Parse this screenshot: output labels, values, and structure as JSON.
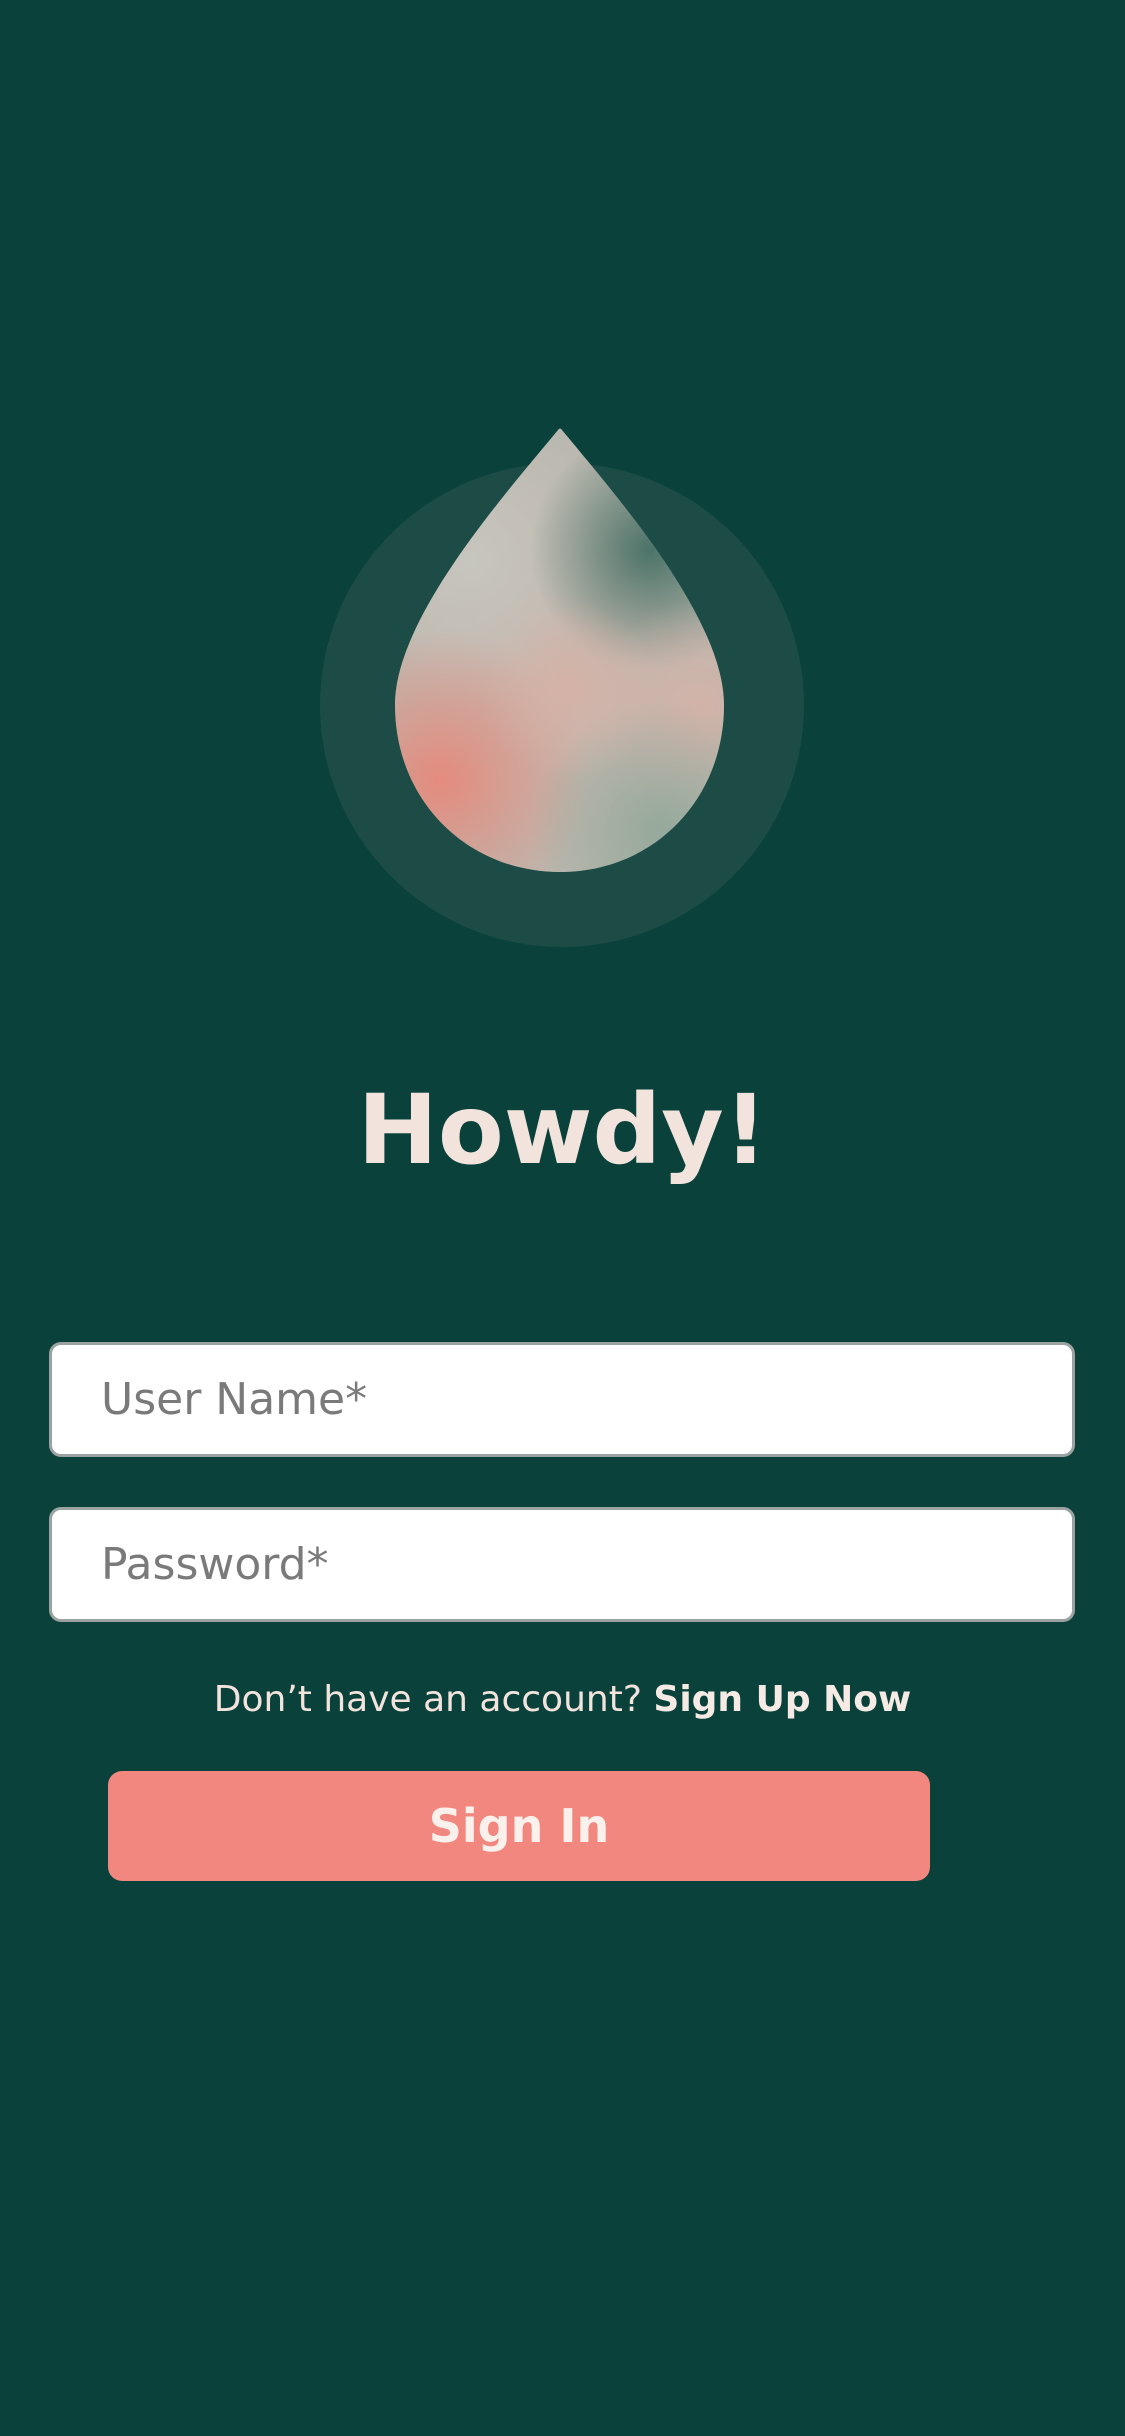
{
  "logo": {
    "icon": "water-drop-icon",
    "background_color": "#0a413b",
    "circle_color": "#1d4c46"
  },
  "title": "Howdy!",
  "form": {
    "username_placeholder": "User Name*",
    "password_placeholder": "Password*"
  },
  "signup": {
    "prompt": "Don’t have an account? ",
    "link_label": "Sign Up Now"
  },
  "signin_button": {
    "label": "Sign In",
    "color": "#f1877e"
  }
}
